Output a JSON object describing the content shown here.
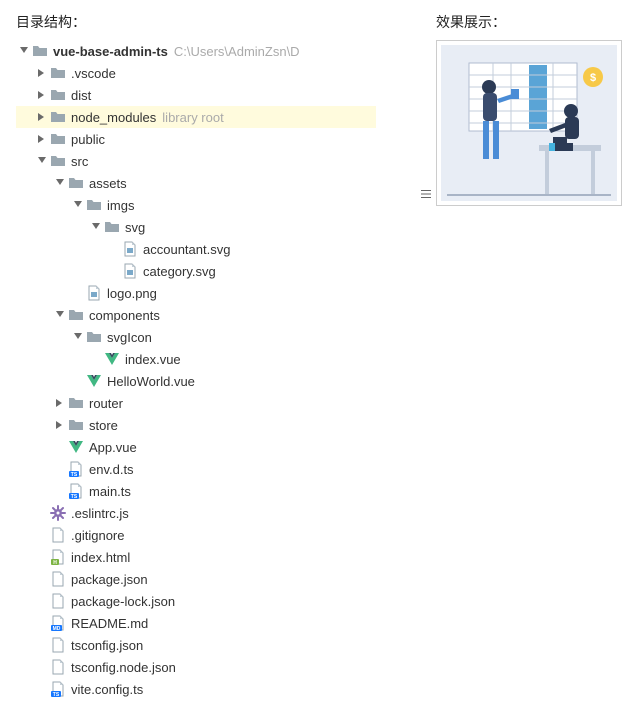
{
  "headings": {
    "tree": "目录结构：",
    "preview": "效果展示："
  },
  "tree": [
    {
      "depth": 0,
      "arrow": "down",
      "icon": "folder",
      "label": "vue-base-admin-ts",
      "bold": true,
      "suffix": "C:\\Users\\AdminZsn\\D"
    },
    {
      "depth": 1,
      "arrow": "right",
      "icon": "folder",
      "label": ".vscode"
    },
    {
      "depth": 1,
      "arrow": "right",
      "icon": "folder",
      "label": "dist"
    },
    {
      "depth": 1,
      "arrow": "right",
      "icon": "folder",
      "label": "node_modules",
      "suffix": "library root",
      "highlight": true
    },
    {
      "depth": 1,
      "arrow": "right",
      "icon": "folder",
      "label": "public"
    },
    {
      "depth": 1,
      "arrow": "down",
      "icon": "folder",
      "label": "src"
    },
    {
      "depth": 2,
      "arrow": "down",
      "icon": "folder",
      "label": "assets"
    },
    {
      "depth": 3,
      "arrow": "down",
      "icon": "folder",
      "label": "imgs"
    },
    {
      "depth": 4,
      "arrow": "down",
      "icon": "folder",
      "label": "svg"
    },
    {
      "depth": 5,
      "arrow": "none",
      "icon": "file-img",
      "label": "accountant.svg"
    },
    {
      "depth": 5,
      "arrow": "none",
      "icon": "file-img",
      "label": "category.svg"
    },
    {
      "depth": 3,
      "arrow": "none",
      "icon": "file-img",
      "label": "logo.png"
    },
    {
      "depth": 2,
      "arrow": "down",
      "icon": "folder",
      "label": "components"
    },
    {
      "depth": 3,
      "arrow": "down",
      "icon": "folder",
      "label": "svgIcon"
    },
    {
      "depth": 4,
      "arrow": "none",
      "icon": "vue",
      "label": "index.vue"
    },
    {
      "depth": 3,
      "arrow": "none",
      "icon": "vue",
      "label": "HelloWorld.vue"
    },
    {
      "depth": 2,
      "arrow": "right",
      "icon": "folder",
      "label": "router"
    },
    {
      "depth": 2,
      "arrow": "right",
      "icon": "folder",
      "label": "store"
    },
    {
      "depth": 2,
      "arrow": "none",
      "icon": "vue",
      "label": "App.vue"
    },
    {
      "depth": 2,
      "arrow": "none",
      "icon": "ts",
      "label": "env.d.ts"
    },
    {
      "depth": 2,
      "arrow": "none",
      "icon": "ts",
      "label": "main.ts"
    },
    {
      "depth": 1,
      "arrow": "none",
      "icon": "gear",
      "label": ".eslintrc.js"
    },
    {
      "depth": 1,
      "arrow": "none",
      "icon": "file",
      "label": ".gitignore"
    },
    {
      "depth": 1,
      "arrow": "none",
      "icon": "html",
      "label": "index.html"
    },
    {
      "depth": 1,
      "arrow": "none",
      "icon": "file",
      "label": "package.json"
    },
    {
      "depth": 1,
      "arrow": "none",
      "icon": "file",
      "label": "package-lock.json"
    },
    {
      "depth": 1,
      "arrow": "none",
      "icon": "md",
      "label": "README.md"
    },
    {
      "depth": 1,
      "arrow": "none",
      "icon": "file",
      "label": "tsconfig.json"
    },
    {
      "depth": 1,
      "arrow": "none",
      "icon": "file",
      "label": "tsconfig.node.json"
    },
    {
      "depth": 1,
      "arrow": "none",
      "icon": "ts",
      "label": "vite.config.ts"
    }
  ]
}
